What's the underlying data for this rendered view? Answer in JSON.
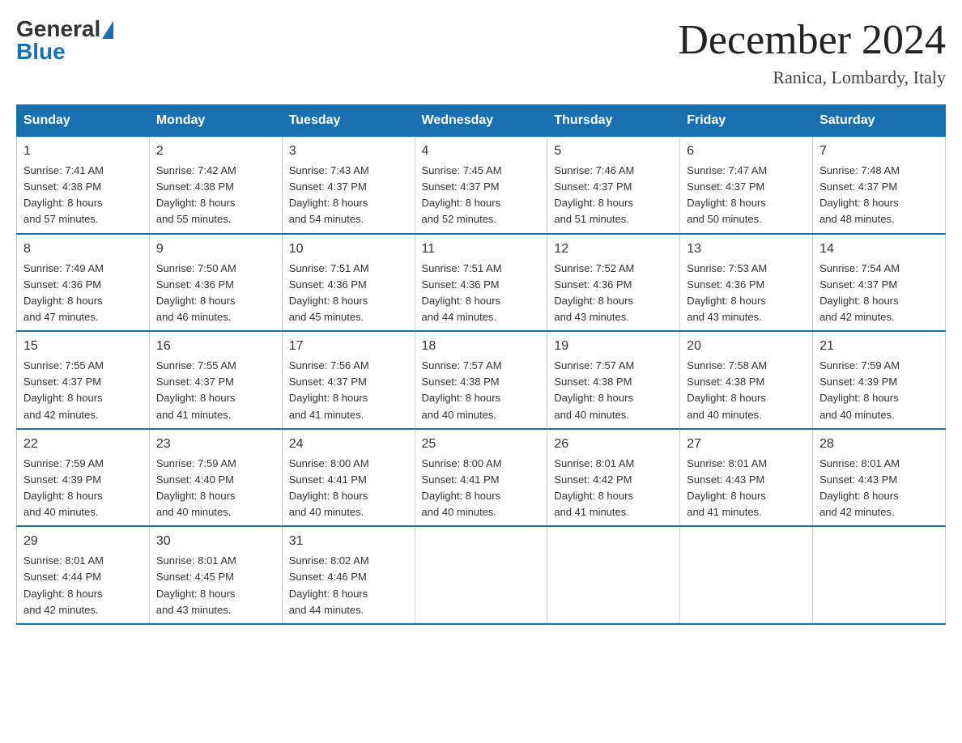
{
  "header": {
    "logo_general": "General",
    "logo_blue": "Blue",
    "month_title": "December 2024",
    "location": "Ranica, Lombardy, Italy"
  },
  "days_of_week": [
    "Sunday",
    "Monday",
    "Tuesday",
    "Wednesday",
    "Thursday",
    "Friday",
    "Saturday"
  ],
  "weeks": [
    [
      {
        "day": "1",
        "sunrise": "7:41 AM",
        "sunset": "4:38 PM",
        "daylight": "8 hours and 57 minutes."
      },
      {
        "day": "2",
        "sunrise": "7:42 AM",
        "sunset": "4:38 PM",
        "daylight": "8 hours and 55 minutes."
      },
      {
        "day": "3",
        "sunrise": "7:43 AM",
        "sunset": "4:37 PM",
        "daylight": "8 hours and 54 minutes."
      },
      {
        "day": "4",
        "sunrise": "7:45 AM",
        "sunset": "4:37 PM",
        "daylight": "8 hours and 52 minutes."
      },
      {
        "day": "5",
        "sunrise": "7:46 AM",
        "sunset": "4:37 PM",
        "daylight": "8 hours and 51 minutes."
      },
      {
        "day": "6",
        "sunrise": "7:47 AM",
        "sunset": "4:37 PM",
        "daylight": "8 hours and 50 minutes."
      },
      {
        "day": "7",
        "sunrise": "7:48 AM",
        "sunset": "4:37 PM",
        "daylight": "8 hours and 48 minutes."
      }
    ],
    [
      {
        "day": "8",
        "sunrise": "7:49 AM",
        "sunset": "4:36 PM",
        "daylight": "8 hours and 47 minutes."
      },
      {
        "day": "9",
        "sunrise": "7:50 AM",
        "sunset": "4:36 PM",
        "daylight": "8 hours and 46 minutes."
      },
      {
        "day": "10",
        "sunrise": "7:51 AM",
        "sunset": "4:36 PM",
        "daylight": "8 hours and 45 minutes."
      },
      {
        "day": "11",
        "sunrise": "7:51 AM",
        "sunset": "4:36 PM",
        "daylight": "8 hours and 44 minutes."
      },
      {
        "day": "12",
        "sunrise": "7:52 AM",
        "sunset": "4:36 PM",
        "daylight": "8 hours and 43 minutes."
      },
      {
        "day": "13",
        "sunrise": "7:53 AM",
        "sunset": "4:36 PM",
        "daylight": "8 hours and 43 minutes."
      },
      {
        "day": "14",
        "sunrise": "7:54 AM",
        "sunset": "4:37 PM",
        "daylight": "8 hours and 42 minutes."
      }
    ],
    [
      {
        "day": "15",
        "sunrise": "7:55 AM",
        "sunset": "4:37 PM",
        "daylight": "8 hours and 42 minutes."
      },
      {
        "day": "16",
        "sunrise": "7:55 AM",
        "sunset": "4:37 PM",
        "daylight": "8 hours and 41 minutes."
      },
      {
        "day": "17",
        "sunrise": "7:56 AM",
        "sunset": "4:37 PM",
        "daylight": "8 hours and 41 minutes."
      },
      {
        "day": "18",
        "sunrise": "7:57 AM",
        "sunset": "4:38 PM",
        "daylight": "8 hours and 40 minutes."
      },
      {
        "day": "19",
        "sunrise": "7:57 AM",
        "sunset": "4:38 PM",
        "daylight": "8 hours and 40 minutes."
      },
      {
        "day": "20",
        "sunrise": "7:58 AM",
        "sunset": "4:38 PM",
        "daylight": "8 hours and 40 minutes."
      },
      {
        "day": "21",
        "sunrise": "7:59 AM",
        "sunset": "4:39 PM",
        "daylight": "8 hours and 40 minutes."
      }
    ],
    [
      {
        "day": "22",
        "sunrise": "7:59 AM",
        "sunset": "4:39 PM",
        "daylight": "8 hours and 40 minutes."
      },
      {
        "day": "23",
        "sunrise": "7:59 AM",
        "sunset": "4:40 PM",
        "daylight": "8 hours and 40 minutes."
      },
      {
        "day": "24",
        "sunrise": "8:00 AM",
        "sunset": "4:41 PM",
        "daylight": "8 hours and 40 minutes."
      },
      {
        "day": "25",
        "sunrise": "8:00 AM",
        "sunset": "4:41 PM",
        "daylight": "8 hours and 40 minutes."
      },
      {
        "day": "26",
        "sunrise": "8:01 AM",
        "sunset": "4:42 PM",
        "daylight": "8 hours and 41 minutes."
      },
      {
        "day": "27",
        "sunrise": "8:01 AM",
        "sunset": "4:43 PM",
        "daylight": "8 hours and 41 minutes."
      },
      {
        "day": "28",
        "sunrise": "8:01 AM",
        "sunset": "4:43 PM",
        "daylight": "8 hours and 42 minutes."
      }
    ],
    [
      {
        "day": "29",
        "sunrise": "8:01 AM",
        "sunset": "4:44 PM",
        "daylight": "8 hours and 42 minutes."
      },
      {
        "day": "30",
        "sunrise": "8:01 AM",
        "sunset": "4:45 PM",
        "daylight": "8 hours and 43 minutes."
      },
      {
        "day": "31",
        "sunrise": "8:02 AM",
        "sunset": "4:46 PM",
        "daylight": "8 hours and 44 minutes."
      },
      null,
      null,
      null,
      null
    ]
  ],
  "labels": {
    "sunrise": "Sunrise:",
    "sunset": "Sunset:",
    "daylight": "Daylight:"
  }
}
